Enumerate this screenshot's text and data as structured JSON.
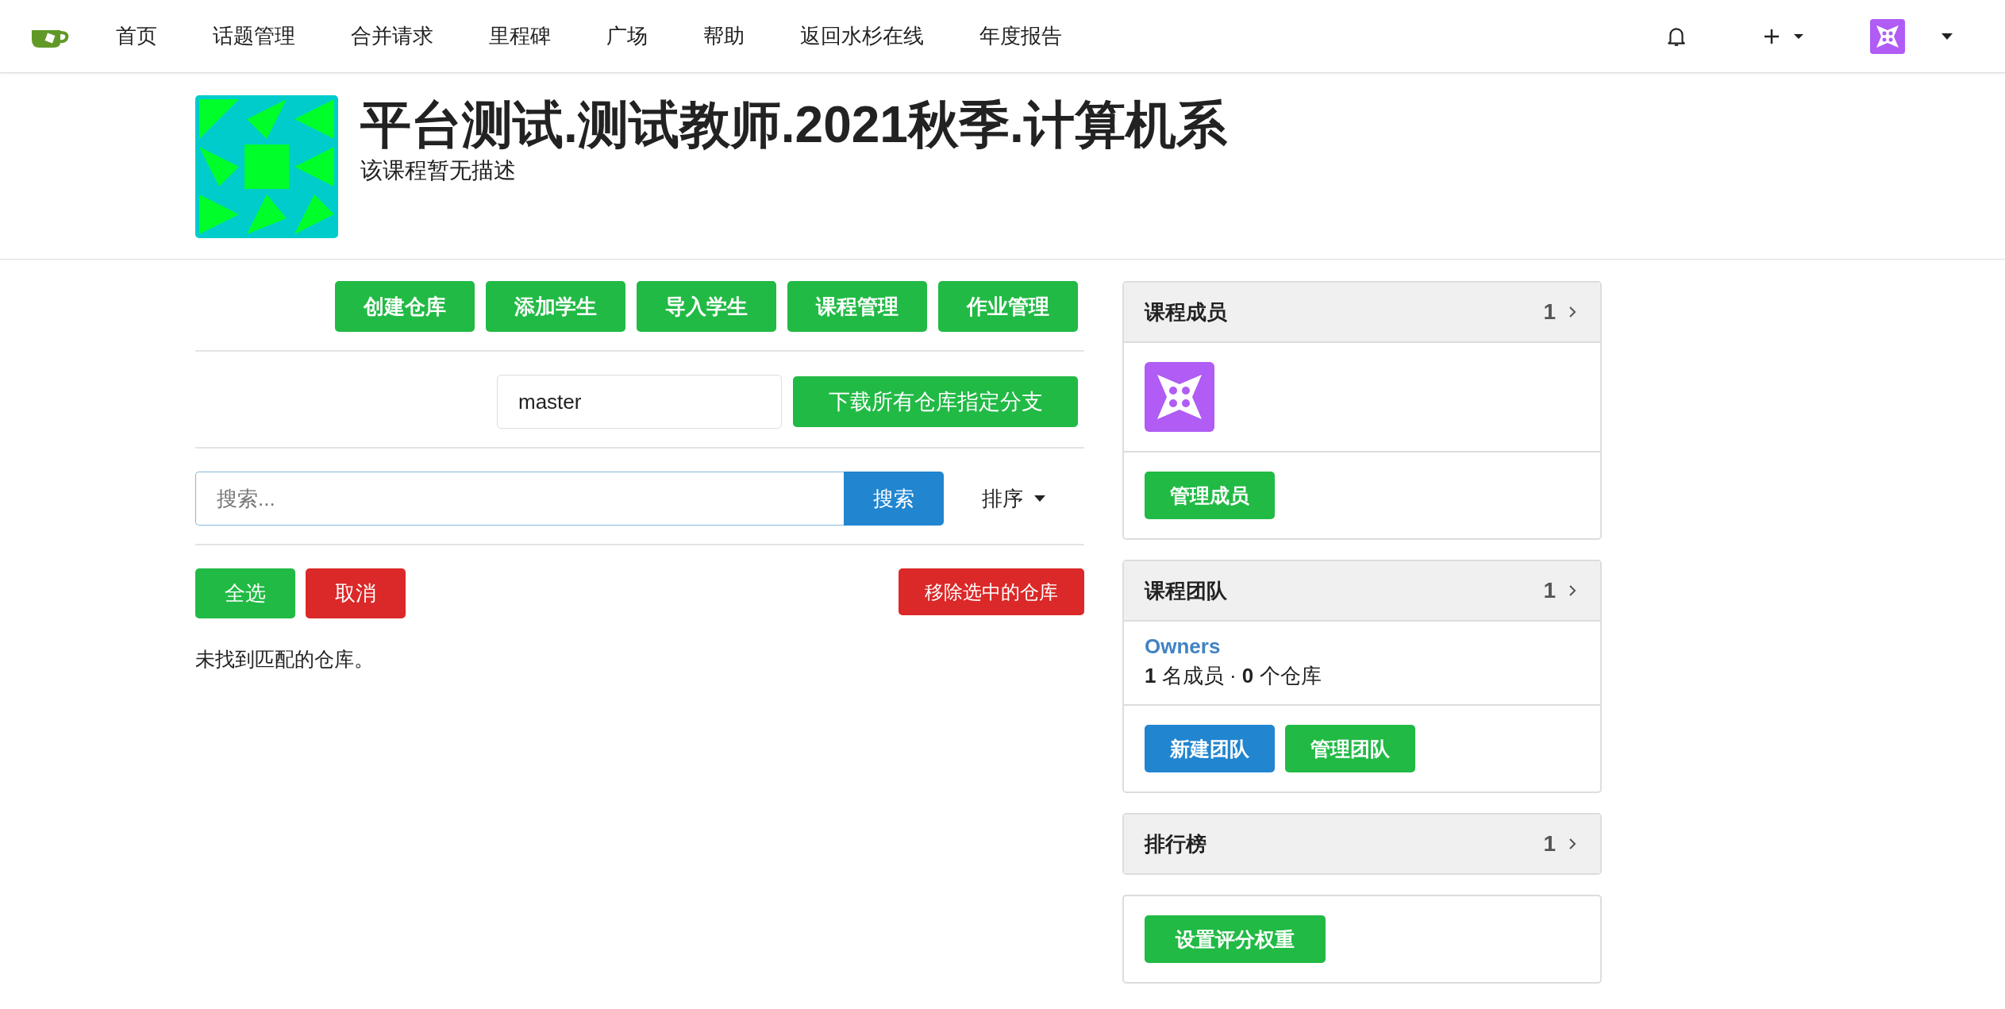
{
  "nav": {
    "items": [
      "首页",
      "话题管理",
      "合并请求",
      "里程碑",
      "广场",
      "帮助",
      "返回水杉在线",
      "年度报告"
    ]
  },
  "header": {
    "title": "平台测试.测试教师.2021秋季.计算机系",
    "description": "该课程暂无描述"
  },
  "actions": [
    {
      "label": "创建仓库",
      "kind": "positive"
    },
    {
      "label": "添加学生",
      "kind": "positive"
    },
    {
      "label": "导入学生",
      "kind": "positive"
    },
    {
      "label": "课程管理",
      "kind": "positive"
    },
    {
      "label": "作业管理",
      "kind": "positive"
    }
  ],
  "branch": {
    "value": "master",
    "button": "下载所有仓库指定分支"
  },
  "search": {
    "placeholder": "搜索...",
    "button": "搜索",
    "sort": "排序"
  },
  "selection": [
    {
      "label": "全选",
      "kind": "positive"
    },
    {
      "label": "取消",
      "kind": "negative"
    },
    {
      "label": "移除选中的仓库",
      "kind": "negative"
    }
  ],
  "empty_message": "未找到匹配的仓库。",
  "members": {
    "title": "课程成员",
    "count": "1",
    "button": "管理成员"
  },
  "teams": {
    "title": "课程团队",
    "count": "1",
    "team": {
      "name": "Owners",
      "summary": "**1** 名成员 · **0** 个仓库"
    },
    "buttons": [
      {
        "label": "新建团队",
        "kind": "primary"
      },
      {
        "label": "管理团队",
        "kind": "positive"
      }
    ]
  },
  "leaderboard": {
    "title": "排行榜",
    "count": "1"
  },
  "weights": {
    "button": "设置评分权重"
  }
}
